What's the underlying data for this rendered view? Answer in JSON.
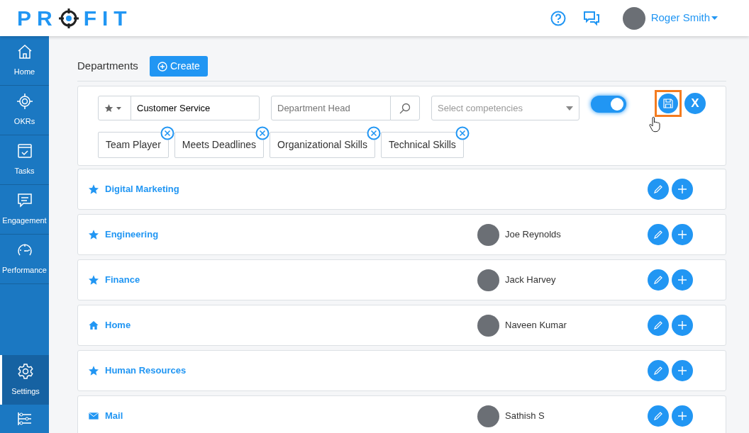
{
  "logo": {
    "before": "PR",
    "after": "FIT"
  },
  "header": {
    "user": "Roger Smith"
  },
  "sidebar": {
    "items": [
      {
        "label": "Home",
        "selected": false
      },
      {
        "label": "OKRs",
        "selected": false
      },
      {
        "label": "Tasks",
        "selected": false
      },
      {
        "label": "Engagement",
        "selected": false
      },
      {
        "label": "Performance",
        "selected": false
      },
      {
        "label": "Settings",
        "selected": true
      }
    ]
  },
  "page": {
    "title": "Departments",
    "create": "Create"
  },
  "editor": {
    "name_value": "Customer Service",
    "head_placeholder": "Department Head",
    "competencies_placeholder": "Select competencies",
    "toggle_on": true,
    "save_highlighted": true,
    "close_label": "X",
    "chips": [
      "Team Player",
      "Meets Deadlines",
      "Organizational Skills",
      "Technical Skills"
    ]
  },
  "departments": [
    {
      "name": "Digital Marketing"
    },
    {
      "name": "Engineering",
      "head": "Joe Reynolds"
    },
    {
      "name": "Finance",
      "head": "Jack Harvey"
    },
    {
      "name": "Home",
      "head": "Naveen Kumar"
    },
    {
      "name": "Human Resources"
    },
    {
      "name": "Mail",
      "head": "Sathish S"
    }
  ]
}
